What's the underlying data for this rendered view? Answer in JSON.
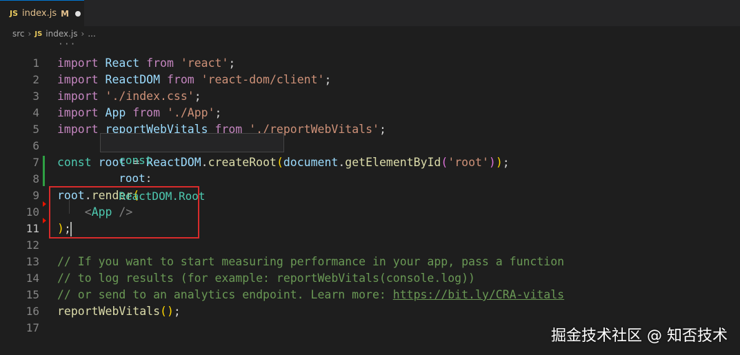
{
  "tab": {
    "icon": "JS",
    "filename": "index.js",
    "status": "M"
  },
  "breadcrumb": {
    "folder": "src",
    "icon": "JS",
    "file": "index.js",
    "more": "..."
  },
  "folded_indicator": "···",
  "hover_tooltip": {
    "keyword": "const",
    "name": "root",
    "colon": ":",
    "type": "ReactDOM.Root"
  },
  "code_lines": [
    {
      "n": "1",
      "tokens": [
        [
          "kw",
          "import"
        ],
        [
          "p",
          " "
        ],
        [
          "var",
          "React"
        ],
        [
          "p",
          " "
        ],
        [
          "kw",
          "from"
        ],
        [
          "p",
          " "
        ],
        [
          "str",
          "'react'"
        ],
        [
          "p",
          ";"
        ]
      ]
    },
    {
      "n": "2",
      "tokens": [
        [
          "kw",
          "import"
        ],
        [
          "p",
          " "
        ],
        [
          "var",
          "ReactDOM"
        ],
        [
          "p",
          " "
        ],
        [
          "kw",
          "from"
        ],
        [
          "p",
          " "
        ],
        [
          "str",
          "'react-dom/client'"
        ],
        [
          "p",
          ";"
        ]
      ]
    },
    {
      "n": "3",
      "tokens": [
        [
          "kw",
          "import"
        ],
        [
          "p",
          " "
        ],
        [
          "str",
          "'./index.css'"
        ],
        [
          "p",
          ";"
        ]
      ]
    },
    {
      "n": "4",
      "tokens": [
        [
          "kw",
          "import"
        ],
        [
          "p",
          " "
        ],
        [
          "var",
          "App"
        ],
        [
          "p",
          " "
        ],
        [
          "kw",
          "from"
        ],
        [
          "p",
          " "
        ],
        [
          "str",
          "'./App'"
        ],
        [
          "p",
          ";"
        ]
      ]
    },
    {
      "n": "5",
      "tokens": [
        [
          "kw",
          "import"
        ],
        [
          "p",
          " "
        ],
        [
          "var",
          "reportWebVitals"
        ],
        [
          "p",
          " "
        ],
        [
          "kw",
          "from"
        ],
        [
          "p",
          " "
        ],
        [
          "str",
          "'./reportWebVitals'"
        ],
        [
          "p",
          ";"
        ]
      ]
    },
    {
      "n": "6",
      "tokens": []
    },
    {
      "n": "7",
      "tokens": [
        [
          "cls",
          "const"
        ],
        [
          "p",
          " "
        ],
        [
          "var",
          "root"
        ],
        [
          "p",
          " = "
        ],
        [
          "var",
          "ReactDOM"
        ],
        [
          "p",
          "."
        ],
        [
          "fn",
          "createRoot"
        ],
        [
          "br1",
          "("
        ],
        [
          "var",
          "document"
        ],
        [
          "p",
          "."
        ],
        [
          "fn",
          "getElementById"
        ],
        [
          "br2",
          "("
        ],
        [
          "str",
          "'root'"
        ],
        [
          "br2",
          ")"
        ],
        [
          "br1",
          ")"
        ],
        [
          "p",
          ";"
        ]
      ]
    },
    {
      "n": "8",
      "tokens": []
    },
    {
      "n": "9",
      "tokens": [
        [
          "var",
          "root"
        ],
        [
          "p",
          "."
        ],
        [
          "fn",
          "render"
        ],
        [
          "br1",
          "("
        ]
      ]
    },
    {
      "n": "10",
      "tokens": [
        [
          "p",
          "    "
        ],
        [
          "jsx",
          "<"
        ],
        [
          "cls",
          "App"
        ],
        [
          "jsx",
          " />"
        ]
      ]
    },
    {
      "n": "11",
      "tokens": [
        [
          "br1",
          ")"
        ],
        [
          "p",
          ";"
        ]
      ]
    },
    {
      "n": "12",
      "tokens": []
    },
    {
      "n": "13",
      "tokens": [
        [
          "cmt",
          "// If you want to start measuring performance in your app, pass a function"
        ]
      ]
    },
    {
      "n": "14",
      "tokens": [
        [
          "cmt",
          "// to log results (for example: reportWebVitals(console.log))"
        ]
      ]
    },
    {
      "n": "15",
      "tokens": [
        [
          "cmt",
          "// or send to an analytics endpoint. Learn more: "
        ],
        [
          "link",
          "https://bit.ly/CRA-vitals"
        ]
      ]
    },
    {
      "n": "16",
      "tokens": [
        [
          "fn",
          "reportWebVitals"
        ],
        [
          "br1",
          "()"
        ],
        [
          "p",
          ";"
        ]
      ]
    },
    {
      "n": "17",
      "tokens": []
    }
  ],
  "active_line": "11",
  "watermark": "掘金技术社区 @ 知否技术",
  "colors": {
    "accent": "#0078d4",
    "highlight_box": "#d92b2b",
    "git_added": "#2ea043",
    "git_deleted": "#e51400"
  }
}
